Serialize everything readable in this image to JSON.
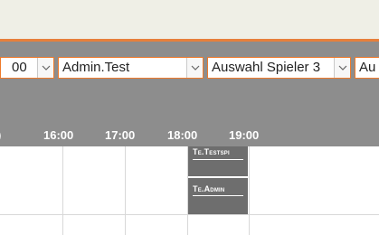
{
  "controls": {
    "time_select": {
      "value": "00"
    },
    "user_select": {
      "value": "Admin.Test"
    },
    "player_select": {
      "value": "Auswahl Spieler 3"
    },
    "extra_select": {
      "value": "Au"
    }
  },
  "timeline": {
    "hours": [
      "16:00",
      "17:00",
      "18:00",
      "19:00"
    ],
    "partial_left": ")"
  },
  "events": [
    {
      "label": "Te.Testspi"
    },
    {
      "label": "Te.Admin"
    }
  ],
  "colors": {
    "accent": "#e77f3b",
    "header_gray": "#8d8d8d",
    "event_gray": "#6e6e6e",
    "top_bg": "#efefe6"
  }
}
